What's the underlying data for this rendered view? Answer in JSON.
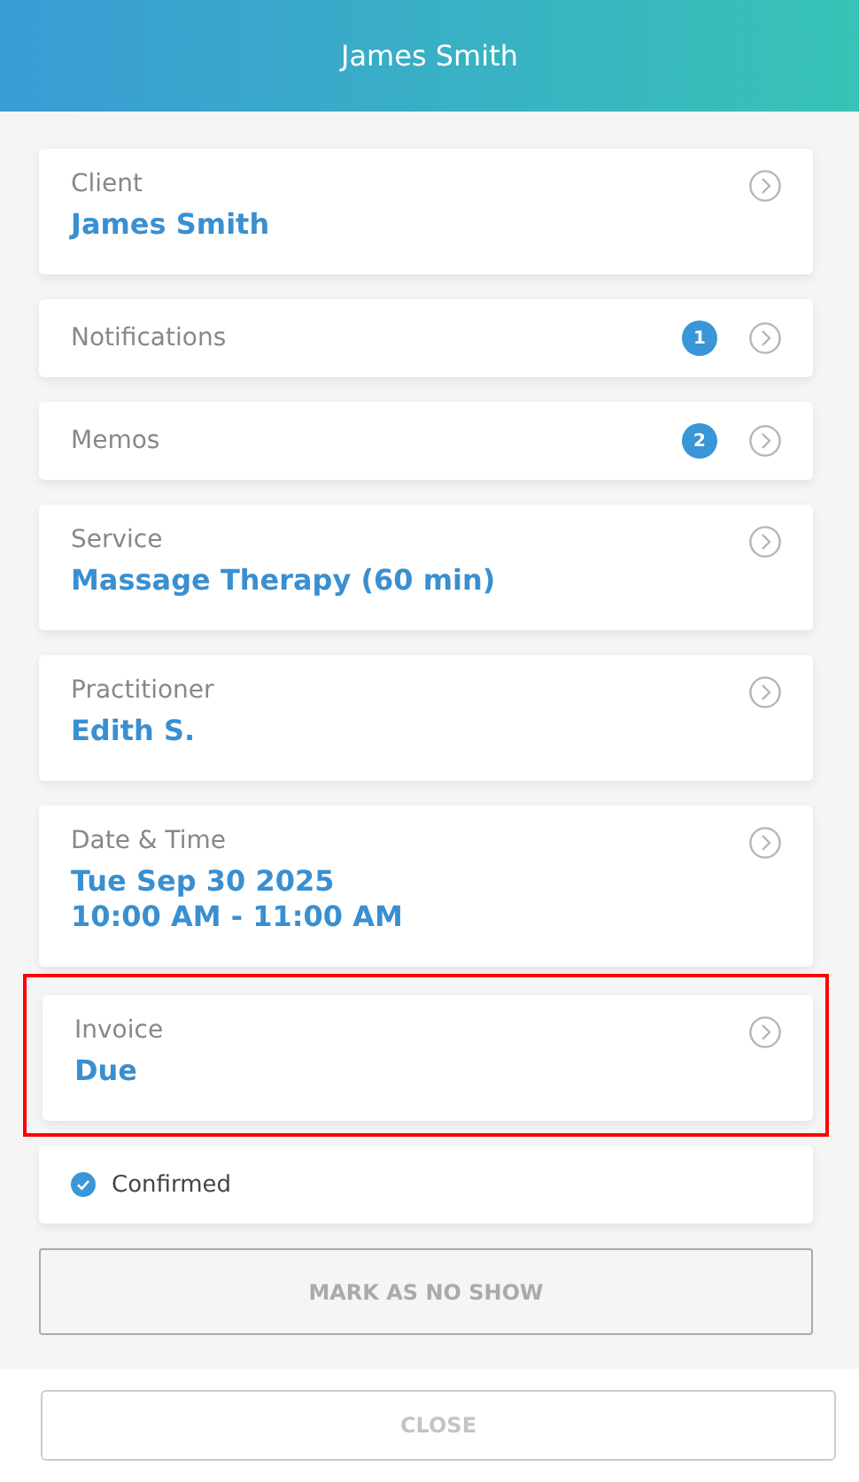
{
  "header": {
    "title": "James Smith"
  },
  "cards": [
    {
      "kind": "field",
      "label": "Client",
      "values": [
        "James Smith"
      ],
      "highlighted": false
    },
    {
      "kind": "count",
      "label": "Notifications",
      "count": "1",
      "highlighted": false
    },
    {
      "kind": "count",
      "label": "Memos",
      "count": "2",
      "highlighted": false
    },
    {
      "kind": "field",
      "label": "Service",
      "values": [
        "Massage Therapy (60 min)"
      ],
      "highlighted": false
    },
    {
      "kind": "field",
      "label": "Practitioner",
      "values": [
        "Edith S."
      ],
      "highlighted": false
    },
    {
      "kind": "field",
      "label": "Date & Time",
      "values": [
        "Tue Sep 30 2025",
        "10:00 AM - 11:00 AM"
      ],
      "highlighted": false
    },
    {
      "kind": "field",
      "label": "Invoice",
      "values": [
        "Due"
      ],
      "highlighted": true
    }
  ],
  "confirmed": {
    "label": "Confirmed",
    "checked": true
  },
  "no_show_button": "MARK AS NO SHOW",
  "close_button": "CLOSE"
}
